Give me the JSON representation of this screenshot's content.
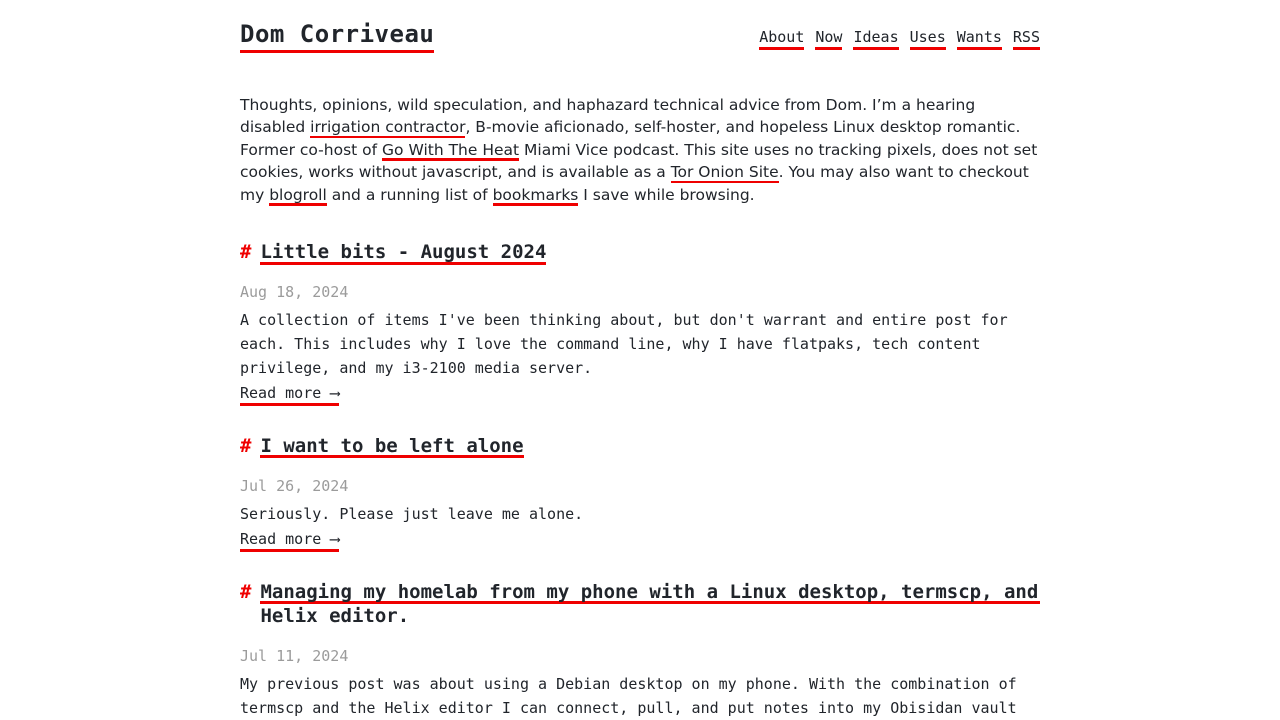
{
  "header": {
    "site_title": "Dom Corriveau",
    "nav": [
      {
        "label": "About"
      },
      {
        "label": "Now"
      },
      {
        "label": "Ideas"
      },
      {
        "label": "Uses"
      },
      {
        "label": "Wants"
      },
      {
        "label": "RSS"
      }
    ]
  },
  "intro": {
    "t1": "Thoughts, opinions, wild speculation, and haphazard technical advice from Dom. I’m a hearing disabled ",
    "link1": "irrigation contractor",
    "t2": ", B-movie aficionado, self-hoster, and hopeless Linux desktop romantic. Former co-host of ",
    "link2": "Go With The Heat",
    "t3": " Miami Vice podcast. This site uses no tracking pixels, does not set cookies, works without javascript, and is available as a ",
    "link3": "Tor Onion Site",
    "t4": ". You may also want to checkout my ",
    "link4": "blogroll",
    "t5": " and a running list of ",
    "link5": "bookmarks",
    "t6": " I save while browsing."
  },
  "posts": [
    {
      "anchor": "#",
      "title": "Little bits - August 2024",
      "date": "Aug 18, 2024",
      "body": "A collection of items I've been thinking about, but don't warrant and entire post for\neach. This includes why I love the command line, why I have flatpaks, tech content\nprivilege, and my i3-2100 media server.",
      "read_more": "Read more ⟶"
    },
    {
      "anchor": "#",
      "title": "I want to be left alone",
      "date": "Jul 26, 2024",
      "body": "Seriously. Please just leave me alone.",
      "read_more": "Read more ⟶"
    },
    {
      "anchor": "#",
      "title": "Managing my homelab from my phone with a Linux desktop, termscp, and Helix editor.",
      "date": "Jul 11, 2024",
      "body": "My previous post was about using a Debian desktop on my phone. With the combination of\ntermscp and the Helix editor I can connect, pull, and put notes into my Obisidan vault",
      "read_more": ""
    }
  ],
  "colors": {
    "accent_red": "#ef0000",
    "text": "#21252b",
    "muted": "#9b9b9b",
    "background": "#ffffff"
  }
}
